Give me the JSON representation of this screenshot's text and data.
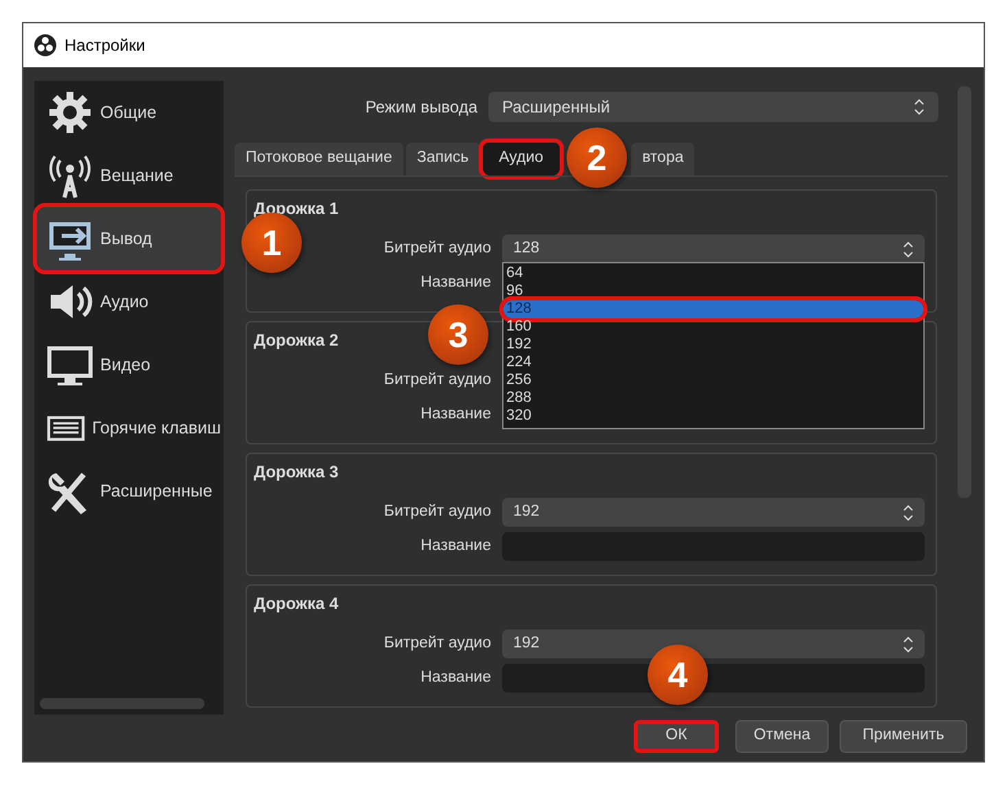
{
  "window": {
    "title": "Настройки"
  },
  "sidebar": {
    "items": [
      {
        "label": "Общие",
        "selected": false,
        "highlighted": false
      },
      {
        "label": "Вещание",
        "selected": false,
        "highlighted": false
      },
      {
        "label": "Вывод",
        "selected": true,
        "highlighted": true
      },
      {
        "label": "Аудио",
        "selected": false,
        "highlighted": false
      },
      {
        "label": "Видео",
        "selected": false,
        "highlighted": false
      },
      {
        "label": "Горячие клавиш",
        "selected": false,
        "highlighted": false
      },
      {
        "label": "Расширенные",
        "selected": false,
        "highlighted": false
      }
    ]
  },
  "output_mode": {
    "label": "Режим вывода",
    "value": "Расширенный"
  },
  "tabs": [
    {
      "label": "Потоковое вещание",
      "selected": false,
      "highlighted": false
    },
    {
      "label": "Запись",
      "selected": false,
      "highlighted": false
    },
    {
      "label": "Аудио",
      "selected": true,
      "highlighted": true
    },
    {
      "label": "втора",
      "selected": false,
      "highlighted": false
    }
  ],
  "tracks": [
    {
      "title": "Дорожка 1",
      "rows": [
        {
          "label": "Битрейт аудио",
          "kind": "combo",
          "value": "128"
        },
        {
          "label": "Название",
          "kind": "covered"
        }
      ]
    },
    {
      "title": "Дорожка 2",
      "rows": [
        {
          "label": "Битрейт аудио",
          "kind": "covered"
        },
        {
          "label": "Название",
          "kind": "covered"
        }
      ]
    },
    {
      "title": "Дорожка 3",
      "rows": [
        {
          "label": "Битрейт аудио",
          "kind": "combo",
          "value": "192"
        },
        {
          "label": "Название",
          "kind": "field"
        }
      ]
    },
    {
      "title": "Дорожка 4",
      "rows": [
        {
          "label": "Битрейт аудио",
          "kind": "combo",
          "value": "192"
        },
        {
          "label": "Название",
          "kind": "field"
        }
      ]
    }
  ],
  "dropdown": {
    "options": [
      {
        "label": "64",
        "selected": false,
        "highlighted": false
      },
      {
        "label": "96",
        "selected": false,
        "highlighted": false
      },
      {
        "label": "128",
        "selected": true,
        "highlighted": true
      },
      {
        "label": "160",
        "selected": false,
        "highlighted": false
      },
      {
        "label": "192",
        "selected": false,
        "highlighted": false
      },
      {
        "label": "224",
        "selected": false,
        "highlighted": false
      },
      {
        "label": "256",
        "selected": false,
        "highlighted": false
      },
      {
        "label": "288",
        "selected": false,
        "highlighted": false
      },
      {
        "label": "320",
        "selected": false,
        "highlighted": false
      }
    ]
  },
  "buttons": [
    {
      "label": "ОК",
      "highlighted": true
    },
    {
      "label": "Отмена",
      "highlighted": false
    },
    {
      "label": "Применить",
      "highlighted": false
    }
  ],
  "step_badges": [
    "1",
    "2",
    "3",
    "4"
  ]
}
